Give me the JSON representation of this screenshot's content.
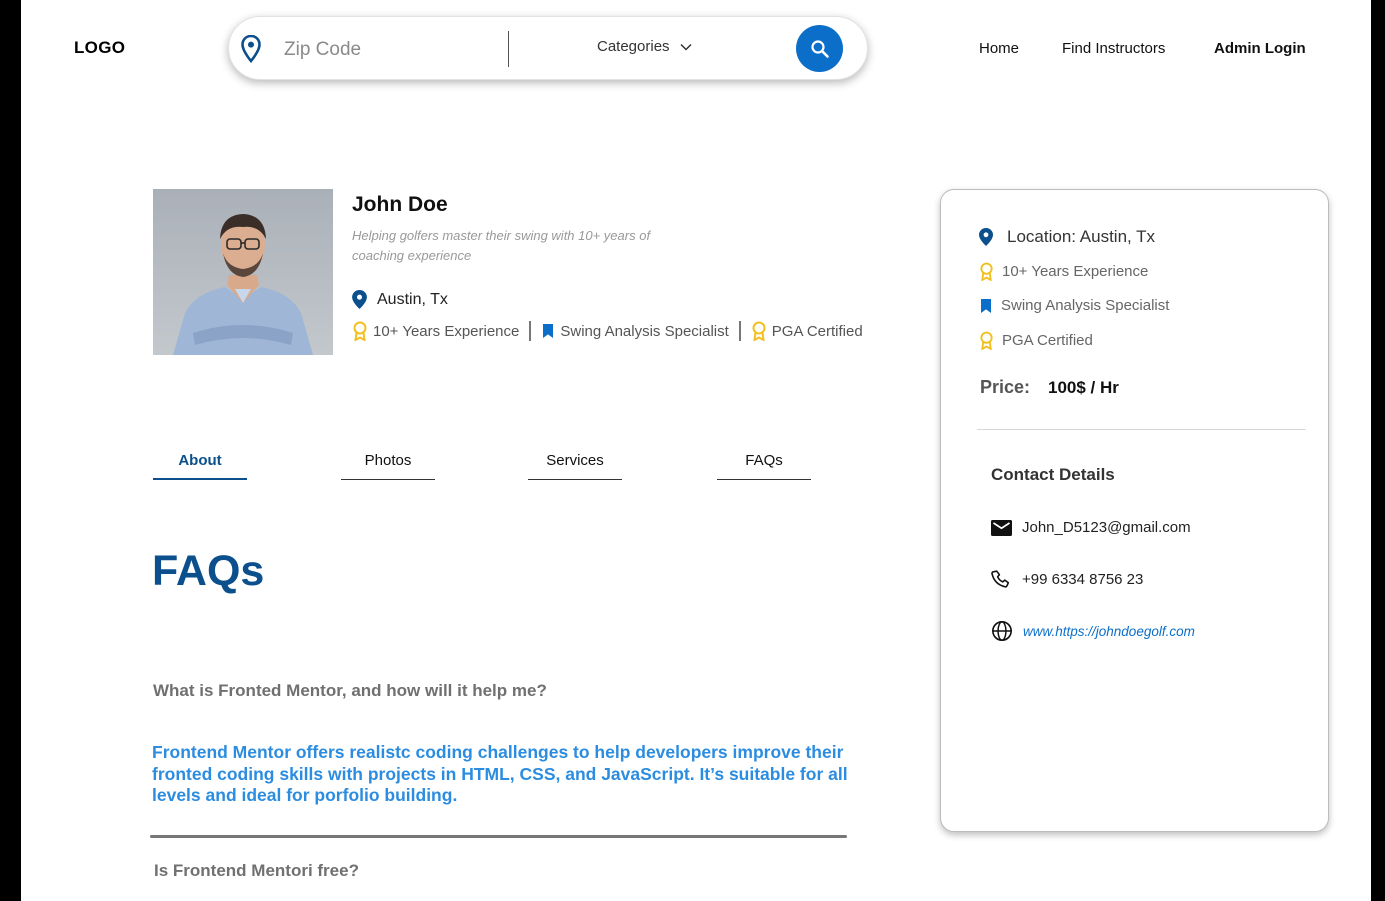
{
  "header": {
    "logo": "LOGO",
    "search": {
      "placeholder": "Zip Code",
      "category_label": "Categories"
    },
    "nav": {
      "home": "Home",
      "find": "Find Instructors",
      "admin": "Admin Login"
    }
  },
  "profile": {
    "name": "John Doe",
    "tagline": "Helping golfers master their swing with 10+ years of coaching experience",
    "location": "Austin, Tx",
    "badges": [
      "10+ Years Experience",
      "Swing Analysis Specialist",
      "PGA Certified"
    ]
  },
  "tabs": [
    "About",
    "Photos",
    "Services",
    "FAQs"
  ],
  "faqs": {
    "title": "FAQs",
    "items": [
      {
        "question": "What is Fronted Mentor, and how will it help me?",
        "answer_lines": [
          "Frontend Mentor offers realistc coding challenges to help developers improve their",
          "fronted coding skills with projects in HTML, CSS, and JavaScript. It’s suitable for all",
          "levels and ideal for porfolio building."
        ]
      },
      {
        "question": "Is Frontend Mentori free?"
      }
    ]
  },
  "sidecard": {
    "location": "Location: Austin, Tx",
    "experience": "10+ Years Experience",
    "specialty": "Swing Analysis Specialist",
    "certification": "PGA Certified",
    "price_label": "Price:",
    "price_value": "100$ / Hr",
    "contact_title": "Contact Details",
    "email": "John_D5123@gmail.com",
    "phone": "+99 6334 8756 23",
    "website": "www.https://johndoegolf.com"
  },
  "colors": {
    "primary": "#0b4f8c",
    "accent": "#0b6fc9",
    "answer": "#2c8de0",
    "badge": "#f2c01e"
  }
}
